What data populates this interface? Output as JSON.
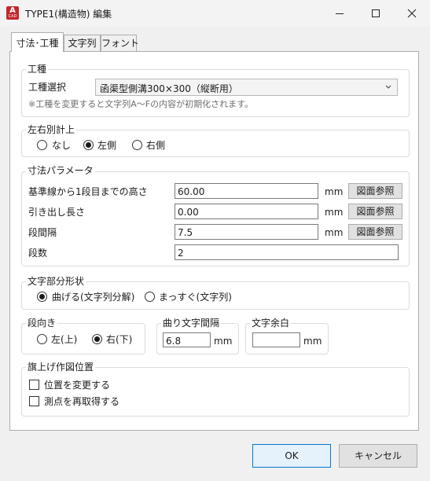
{
  "window": {
    "title": "TYPE1(構造物) 編集",
    "app_icon_letter": "A",
    "app_icon_sub": "CAD",
    "accent_color": "#c4262e"
  },
  "tabs": [
    {
      "label": "寸法･工種",
      "active": true
    },
    {
      "label": "文字列",
      "active": false
    },
    {
      "label": "フォント",
      "active": false
    }
  ],
  "work_type": {
    "group_label": "工種",
    "select_label": "工種選択",
    "select_value": "函渠型側溝300×300（縦断用）",
    "note": "※工種を変更すると文字列A～Fの内容が初期化されます。"
  },
  "left_right": {
    "group_label": "左右別計上",
    "options": [
      "なし",
      "左側",
      "右側"
    ],
    "selected": "左側"
  },
  "dimension": {
    "group_label": "寸法パラメータ",
    "rows": [
      {
        "label": "基準線から1段目までの高さ",
        "value": "60.00",
        "unit": "mm",
        "button": "図面参照"
      },
      {
        "label": "引き出し長さ",
        "value": "0.00",
        "unit": "mm",
        "button": "図面参照"
      },
      {
        "label": "段間隔",
        "value": "7.5",
        "unit": "mm",
        "button": "図面参照"
      },
      {
        "label": "段数",
        "value": "2"
      }
    ]
  },
  "text_shape": {
    "group_label": "文字部分形状",
    "options": [
      "曲げる(文字列分解)",
      "まっすぐ(文字列)"
    ],
    "selected": "曲げる(文字列分解)"
  },
  "step_direction": {
    "group_label": "段向き",
    "options": [
      "左(上)",
      "右(下)"
    ],
    "selected": "右(下)"
  },
  "bend_spacing": {
    "group_label": "曲り文字間隔",
    "value": "6.8",
    "unit": "mm"
  },
  "text_margin": {
    "group_label": "文字余白",
    "value": "",
    "unit": "mm"
  },
  "flag_position": {
    "group_label": "旗上げ作図位置",
    "checks": [
      {
        "label": "位置を変更する",
        "checked": false
      },
      {
        "label": "測点を再取得する",
        "checked": false
      }
    ]
  },
  "footer": {
    "ok": "OK",
    "cancel": "キャンセル"
  }
}
